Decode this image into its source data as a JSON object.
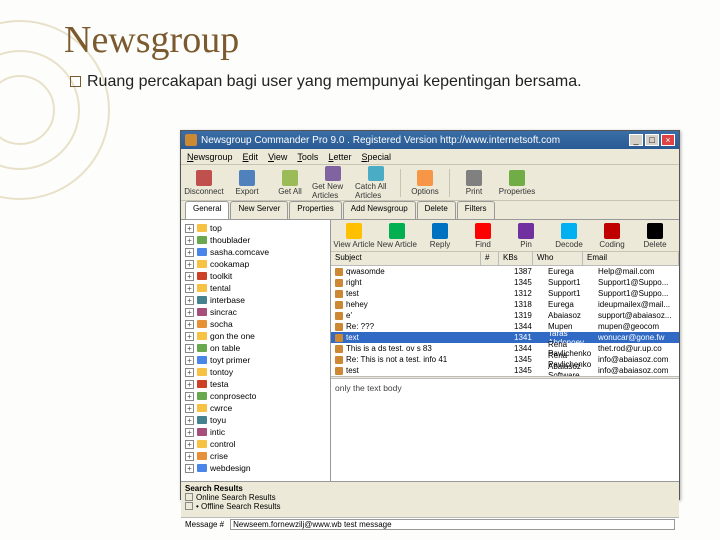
{
  "slide": {
    "title": "Newsgroup",
    "bullet": "Ruang percakapan bagi user yang mempunyai kepentingan bersama."
  },
  "colors": {
    "disconnect": "#c0504d",
    "export": "#4f81bd",
    "getall": "#9bbb59",
    "getnews": "#8064a2",
    "catchall": "#4bacc6",
    "options": "#f79646",
    "print": "#808080",
    "properties": "#70ad47",
    "view": "#ffc000",
    "new": "#00b050",
    "reply": "#0070c0",
    "find": "#ff0000",
    "pin": "#7030a0",
    "decode": "#00b0f0",
    "coding": "#c00000",
    "delete": "#000000",
    "folder": "#f6c244",
    "folderAlt": "#6aa84f",
    "folderBlue": "#4a86e8",
    "folderRed": "#cc4125",
    "folderPurple": "#a64d79",
    "folderTeal": "#45818e",
    "folderOrange": "#e69138"
  },
  "app": {
    "title": "Newsgroup Commander Pro 9.0 . Registered Version     http://www.internetsoft.com",
    "menus": [
      "Newsgroup",
      "Edit",
      "View",
      "Tools",
      "Letter",
      "Special"
    ],
    "toolbar": [
      {
        "l": "Disconnect",
        "c": "disconnect"
      },
      {
        "l": "Export",
        "c": "export"
      },
      {
        "l": "Get All",
        "c": "getall"
      },
      {
        "l": "Get New Articles",
        "c": "getnews"
      },
      {
        "l": "Catch All Articles",
        "c": "catchall"
      },
      {
        "l": "sep"
      },
      {
        "l": "Options",
        "c": "options"
      },
      {
        "l": "sep"
      },
      {
        "l": "Print",
        "c": "print"
      },
      {
        "l": "Properties",
        "c": "properties"
      }
    ],
    "toolbar2": [
      {
        "l": "View Article",
        "c": "view"
      },
      {
        "l": "New Article",
        "c": "new"
      },
      {
        "l": "Reply",
        "c": "reply"
      },
      {
        "l": "Find",
        "c": "find"
      },
      {
        "l": "Pin",
        "c": "pin"
      },
      {
        "l": "Decode",
        "c": "decode"
      },
      {
        "l": "Coding",
        "c": "coding"
      },
      {
        "l": "Delete",
        "c": "delete"
      }
    ],
    "tabs": [
      "General",
      "New Server",
      "Properties",
      "Add Newsgroup",
      "Delete",
      "Filters"
    ],
    "activeTab": 0,
    "tree": [
      {
        "t": "top",
        "c": "folder"
      },
      {
        "t": "thoublader",
        "c": "folderAlt"
      },
      {
        "t": "sasha.comcave",
        "c": "folderBlue"
      },
      {
        "t": "cookamap",
        "c": "folder"
      },
      {
        "t": "toolkit",
        "c": "folderRed"
      },
      {
        "t": "tental",
        "c": "folder"
      },
      {
        "t": "interbase",
        "c": "folderTeal"
      },
      {
        "t": "sincrac",
        "c": "folderPurple"
      },
      {
        "t": "socha",
        "c": "folderOrange"
      },
      {
        "t": "gon the one",
        "c": "folder"
      },
      {
        "t": "on table",
        "c": "folderAlt"
      },
      {
        "t": "toyt primer",
        "c": "folderBlue"
      },
      {
        "t": "tontoy",
        "c": "folder"
      },
      {
        "t": "testa",
        "c": "folderRed"
      },
      {
        "t": "conprosecto",
        "c": "folderAlt"
      },
      {
        "t": "cwrce",
        "c": "folder"
      },
      {
        "t": "toyu",
        "c": "folderTeal"
      },
      {
        "t": "intic",
        "c": "folderPurple"
      },
      {
        "t": "control",
        "c": "folder"
      },
      {
        "t": "crise",
        "c": "folderOrange"
      },
      {
        "t": "webdesign",
        "c": "folderBlue"
      }
    ],
    "columns": {
      "subject": "Subject",
      "flag": "#",
      "kb": "KBs",
      "who": "Who",
      "email": "Email"
    },
    "rows": [
      {
        "s": "qwasomde",
        "k": "1387",
        "w": "Eurega",
        "e": "Help@mail.com"
      },
      {
        "s": "right",
        "k": "1345",
        "w": "Support1",
        "e": "Support1@Suppo..."
      },
      {
        "s": "test",
        "k": "1312",
        "w": "Support1",
        "e": "Support1@Suppo..."
      },
      {
        "s": "hehey",
        "k": "1318",
        "w": "Eurega",
        "e": "ideupmailex@mail..."
      },
      {
        "s": "e'",
        "k": "1319",
        "w": "Abaiasoz",
        "e": "support@abaiasoz..."
      },
      {
        "s": "Re: ???",
        "k": "1344",
        "w": "Mupen",
        "e": "mupen@geocom"
      },
      {
        "s": "text",
        "k": "1341",
        "w": "Taras Abdenoev",
        "e": "wonucar@gone.fw",
        "sel": true
      },
      {
        "s": "This is a ds test.  ov s 83",
        "k": "1344",
        "w": "Rena Pavlichenko",
        "e": "thet.rod@ur.up.co"
      },
      {
        "s": "Re: This is not a test.  info 41",
        "k": "1345",
        "w": "Rena Pavlichenko",
        "e": "info@abaiasoz.com"
      },
      {
        "s": "test",
        "k": "1345",
        "w": "Abaiasoz Software",
        "e": "info@abaiasoz.com"
      }
    ],
    "preview": "only the text body",
    "search": {
      "label": "Search Results",
      "items": [
        "Online Search Results",
        "Offline Search Results"
      ]
    },
    "status": {
      "msgLabel": "Message #",
      "placeholder": "Newseem.fornewzilj@www.wb test message"
    }
  }
}
